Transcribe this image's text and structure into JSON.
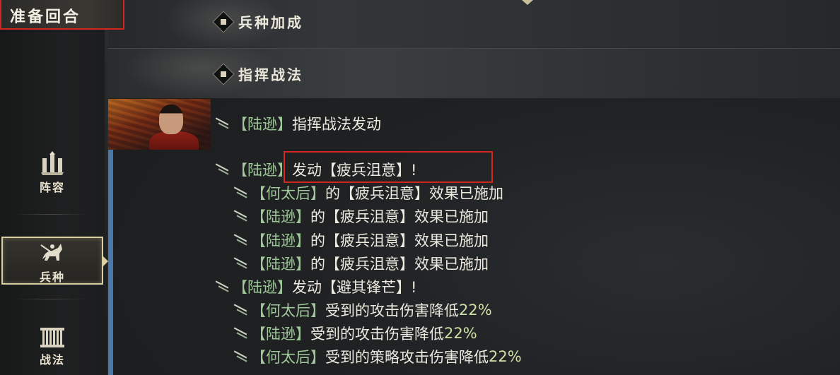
{
  "sidebar": {
    "round_title": "准备回合",
    "items": [
      {
        "label": "阵容",
        "icon": "formation-icon",
        "active": false
      },
      {
        "label": "兵种",
        "icon": "cavalry-icon",
        "active": true
      },
      {
        "label": "战法",
        "icon": "tactics-icon",
        "active": false
      }
    ]
  },
  "headers": {
    "troop_bonus": "兵种加成",
    "command_tactics": "指挥战法"
  },
  "log": [
    {
      "indent": 0,
      "name": "陆逊",
      "text": "指挥战法发动",
      "num": ""
    },
    {
      "indent": 0,
      "name": "陆逊",
      "text": "发动【疲兵沮意】!",
      "num": ""
    },
    {
      "indent": 1,
      "name": "何太后",
      "text": "的【疲兵沮意】效果已施加",
      "num": ""
    },
    {
      "indent": 1,
      "name": "陆逊",
      "text": "的【疲兵沮意】效果已施加",
      "num": ""
    },
    {
      "indent": 1,
      "name": "陆逊",
      "text": "的【疲兵沮意】效果已施加",
      "num": ""
    },
    {
      "indent": 1,
      "name": "陆逊",
      "text": "的【疲兵沮意】效果已施加",
      "num": ""
    },
    {
      "indent": 0,
      "name": "陆逊",
      "text": "发动【避其锋芒】!",
      "num": ""
    },
    {
      "indent": 1,
      "name": "何太后",
      "text": "受到的攻击伤害降低",
      "num": "22%"
    },
    {
      "indent": 1,
      "name": "陆逊",
      "text": "受到的攻击伤害降低",
      "num": "22%"
    },
    {
      "indent": 1,
      "name": "何太后",
      "text": "受到的策略攻击伤害降低",
      "num": "22%"
    }
  ],
  "colors": {
    "highlight_box": "#d3261f",
    "name_green": "#9fc79a",
    "accent_blue": "#4a78a8"
  }
}
